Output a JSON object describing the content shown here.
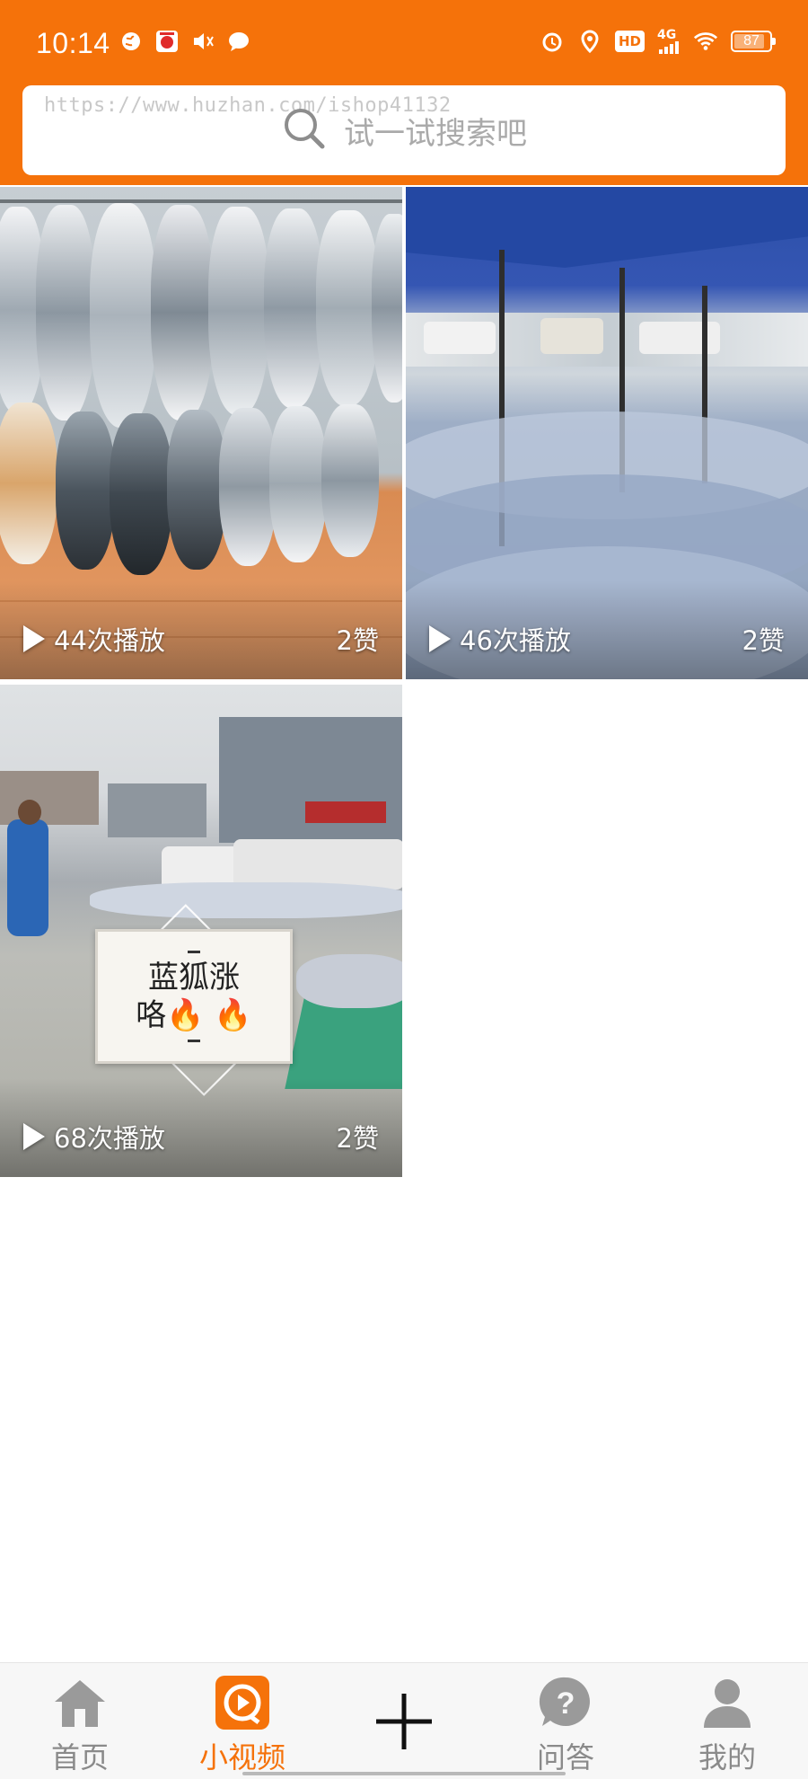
{
  "status_bar": {
    "time": "10:14",
    "network": "4G",
    "hd_badge": "HD",
    "battery": "87",
    "battery_level": 0.87
  },
  "search": {
    "placeholder": "试一试搜索吧",
    "watermark": "https://www.huzhan.com/ishop41132"
  },
  "videos": [
    {
      "plays": "44次播放",
      "likes": "2赞"
    },
    {
      "plays": "46次播放",
      "likes": "2赞"
    },
    {
      "plays": "68次播放",
      "likes": "2赞",
      "caption_line1": "蓝狐涨",
      "caption_line2": "咯🔥 🔥"
    }
  ],
  "nav": {
    "items": [
      {
        "label": "首页",
        "icon": "home-icon",
        "active": false
      },
      {
        "label": "小视频",
        "icon": "video-icon",
        "active": true
      },
      {
        "label": "",
        "icon": "plus-icon",
        "active": false
      },
      {
        "label": "问答",
        "icon": "question-icon",
        "active": false
      },
      {
        "label": "我的",
        "icon": "user-icon",
        "active": false
      }
    ]
  },
  "colors": {
    "brand": "#f5720a",
    "nav_inactive": "#8a8a8a",
    "background": "#ffffff"
  }
}
